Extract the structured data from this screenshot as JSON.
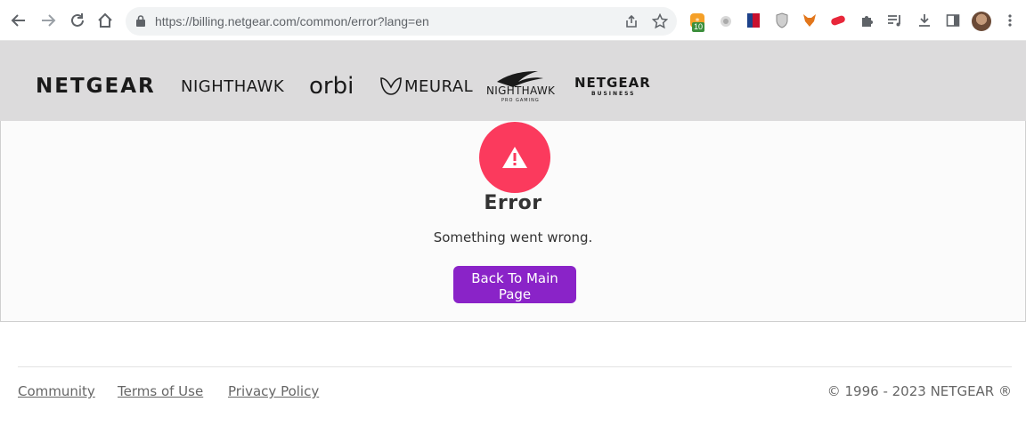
{
  "browser": {
    "url_host": "https://billing.netgear.com",
    "url_path": "/common/error?lang=en",
    "extension_badge": "10"
  },
  "brands": {
    "netgear": "NETGEAR",
    "nighthawk": "NIGHTHAWK",
    "orbi": "orbi",
    "meural": "MEURAL",
    "nighthawk_pro": "NIGHTHAWK",
    "nighthawk_pro_sub": "PRO GAMING",
    "netgear_business": "NETGEAR",
    "netgear_business_sub": "BUSINESS"
  },
  "error": {
    "title": "Error",
    "message": "Something went wrong.",
    "button_label": "Back To Main Page",
    "icon": "warning-triangle-icon",
    "accent_color": "#fb3a5d",
    "button_color": "#8a23c8"
  },
  "footer": {
    "links": [
      "Community",
      "Terms of Use",
      "Privacy Policy"
    ],
    "copyright": "© 1996 - 2023 NETGEAR ®"
  }
}
